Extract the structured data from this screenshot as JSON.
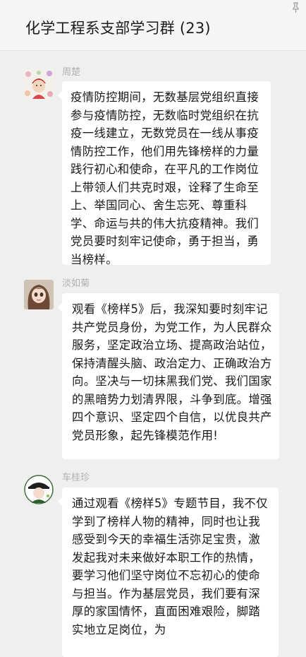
{
  "header": {
    "title": "化学工程系支部学习群 (23)",
    "pin_icon": "pin-icon"
  },
  "messages": [
    {
      "sender": "周楚",
      "avatar": "avatar-baby-flowers",
      "text": "疫情防控期间，无数基层党组织直接参与疫情防控，无数临时党组织在抗疫一线建立，无数党员在一线从事疫情防控工作，他们用先锋榜样的力量践行初心和使命，在平凡的工作岗位上带领人们共克时艰，诠释了生命至上、举国同心、舍生忘死、尊重科学、命运与共的伟大抗疫精神。我们党员要时刻牢记使命，勇于担当，勇当榜样。"
    },
    {
      "sender": "淡如菊",
      "avatar": "avatar-cartoon-girl",
      "text": "观看《榜样5》后，我深知要时刻牢记共产党员身份，为党工作，为人民群众服务，坚定政治立场、提高政治站位，保持清醒头脑、政治定力、正确政治方向。坚决与一切抹黑我们党、我们国家的黑暗势力划清界限，斗争到底。增强四个意识、坚定四个自信，以优良共产党员形象，起先锋模范作用!"
    },
    {
      "sender": "车桂珍",
      "avatar": "avatar-cartoon-hat",
      "text": "通过观看《榜样5》专题节目，我不仅学到了榜样人物的精神，同时也让我感受到今天的幸福生活弥足宝贵，激发起我对未来做好本职工作的热情，要学习他们坚守岗位不忘初心的使命与担当。作为基层党员，我们要有深厚的家国情怀，直面困难艰险，脚踏实地立足岗位，为"
    }
  ]
}
